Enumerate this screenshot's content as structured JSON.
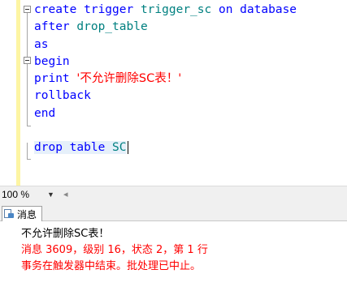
{
  "editor": {
    "lines": [
      {
        "kw": "create trigger ",
        "id": "trigger_sc",
        "kw2": " on database"
      },
      {
        "kw": "after ",
        "id": "drop_table"
      },
      {
        "kw": "as"
      },
      {
        "kw": "begin"
      },
      {
        "kw": "print ",
        "str": "'不允许删除SC表！'"
      },
      {
        "kw": "rollback"
      },
      {
        "kw": "end"
      },
      {
        "kw": "drop table ",
        "id": "SC"
      }
    ]
  },
  "zoom": {
    "value": "100 %"
  },
  "results": {
    "tab_label": "消息",
    "messages": [
      "不允许删除SC表！",
      "消息 3609，级别 16，状态 2，第 1 行",
      "事务在触发器中结束。批处理已中止。"
    ]
  },
  "colors": {
    "keyword": "#0000ff",
    "identifier": "#008080",
    "string": "#ff0000",
    "error": "#ff0000"
  }
}
